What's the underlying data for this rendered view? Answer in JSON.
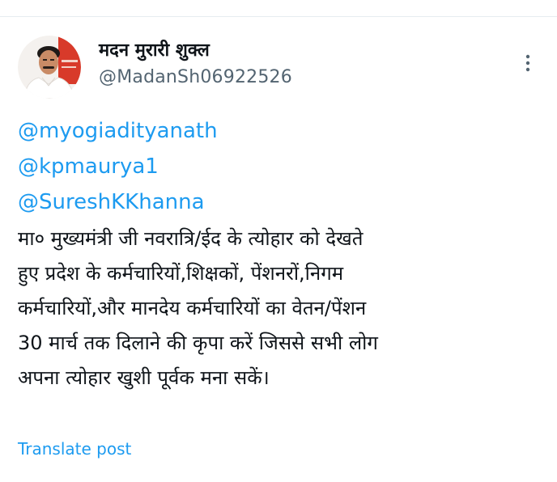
{
  "post": {
    "author": {
      "display_name": "मदन मुरारी शुक्ल",
      "handle": "@MadanSh06922526",
      "avatar_icon": "profile-photo"
    },
    "more_icon": "vertical-ellipsis-icon",
    "mentions": [
      {
        "text": "@myogiadityanath"
      },
      {
        "text": "@kpmaurya1"
      },
      {
        "text": "@SureshKKhanna"
      }
    ],
    "body_lines": [
      {
        "text": "मा० मुख्यमंत्री जी नवरात्रि/ईद के त्योहार को देखते"
      },
      {
        "text": "हुए प्रदेश के कर्मचारियों,शिक्षकों,  पेंशनरों,निगम"
      },
      {
        "text": "कर्मचारियों,और मानदेय कर्मचारियों का वेतन/पेंशन"
      },
      {
        "text": "30 मार्च तक दिलाने की कृपा करें जिससे सभी लोग"
      },
      {
        "text": "अपना त्योहार खुशी पूर्वक मना सकें।"
      }
    ],
    "translate_label": "Translate post"
  },
  "colors": {
    "link": "#1d9bf0",
    "text": "#0f1419",
    "secondary": "#536471",
    "divider": "#e6ecf0"
  }
}
